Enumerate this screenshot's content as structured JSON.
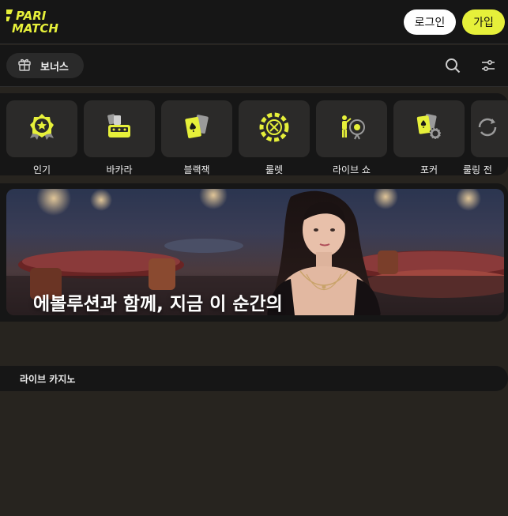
{
  "header": {
    "logo_line1": "PARI",
    "logo_line2": "MATCH",
    "login_label": "로그인",
    "join_label": "가입"
  },
  "subbar": {
    "bonus_label": "보너스",
    "search_icon": "search-icon",
    "filter_icon": "filter-sliders-icon"
  },
  "categories": [
    {
      "label": "인기",
      "icon": "badge-star-icon"
    },
    {
      "label": "바카라",
      "icon": "baccarat-icon"
    },
    {
      "label": "블랙잭",
      "icon": "playing-cards-icon"
    },
    {
      "label": "룰렛",
      "icon": "roulette-icon"
    },
    {
      "label": "라이브 쇼",
      "icon": "live-show-icon"
    },
    {
      "label": "포커",
      "icon": "poker-chip-cards-icon"
    },
    {
      "label": "룰링 전",
      "icon": "refresh-icon"
    }
  ],
  "banner": {
    "title": "에볼루션과 함께, 지금 이 순간의"
  },
  "section": {
    "title": "라이브 카지노"
  },
  "colors": {
    "accent": "#e6f03a",
    "header_bg": "#161616",
    "page_bg": "#27241f",
    "tile_bg": "#2b2a29"
  }
}
